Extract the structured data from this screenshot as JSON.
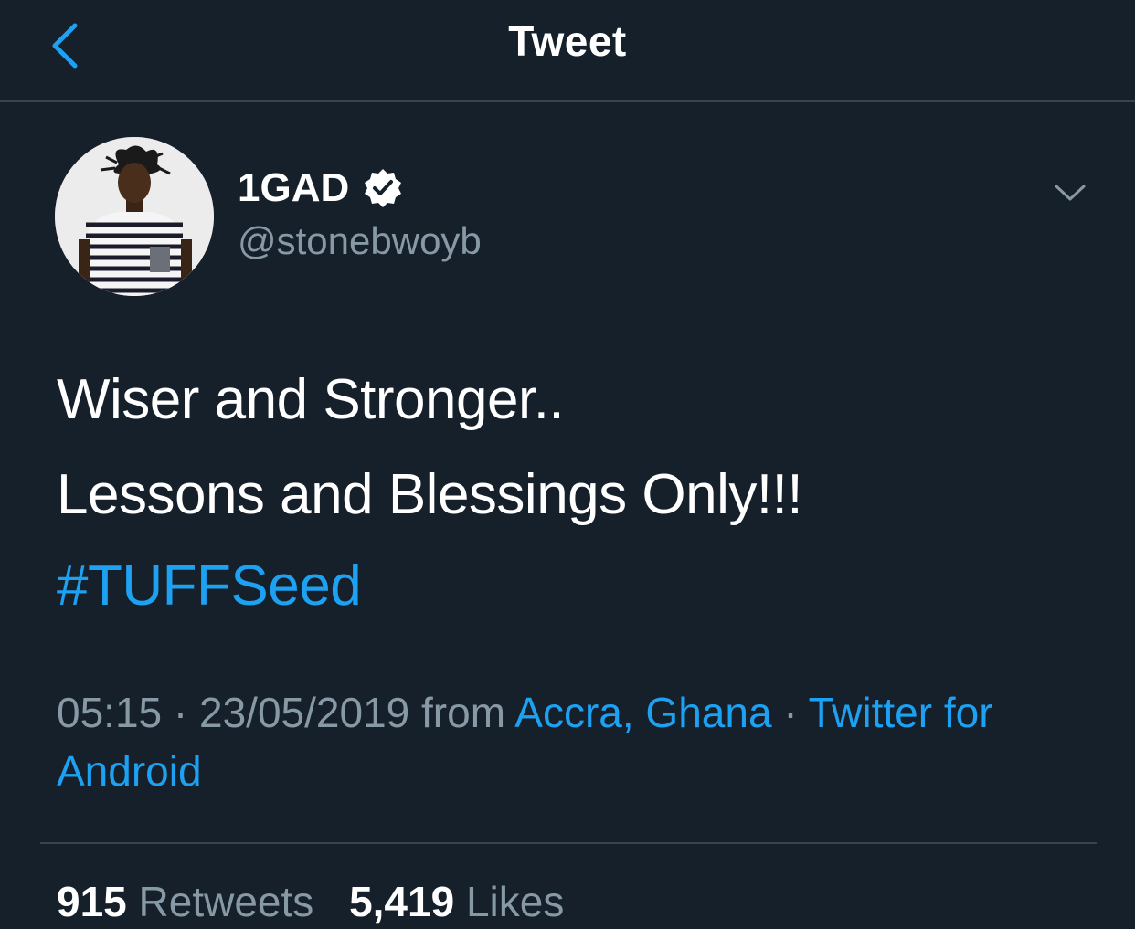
{
  "header": {
    "title": "Tweet",
    "back_icon": "chevron-left-icon"
  },
  "author": {
    "display_name": "1GAD",
    "handle": "@stonebwoyb",
    "verified": true,
    "verified_icon": "verified-badge-icon",
    "menu_icon": "chevron-down-icon"
  },
  "tweet": {
    "lines": [
      "Wiser and Stronger..",
      "Lessons and Blessings Only!!!"
    ],
    "hashtag": "#TUFFSeed"
  },
  "meta": {
    "time": "05:15",
    "separator": "·",
    "date": "23/05/2019",
    "from_label": "from",
    "location": "Accra, Ghana",
    "source": "Twitter for Android"
  },
  "stats": {
    "retweets_count": "915",
    "retweets_label": "Retweets",
    "likes_count": "5,419",
    "likes_label": "Likes"
  },
  "colors": {
    "background": "#15202b",
    "accent": "#1da1f2",
    "secondary_text": "#8899a6",
    "divider": "#38444d"
  }
}
